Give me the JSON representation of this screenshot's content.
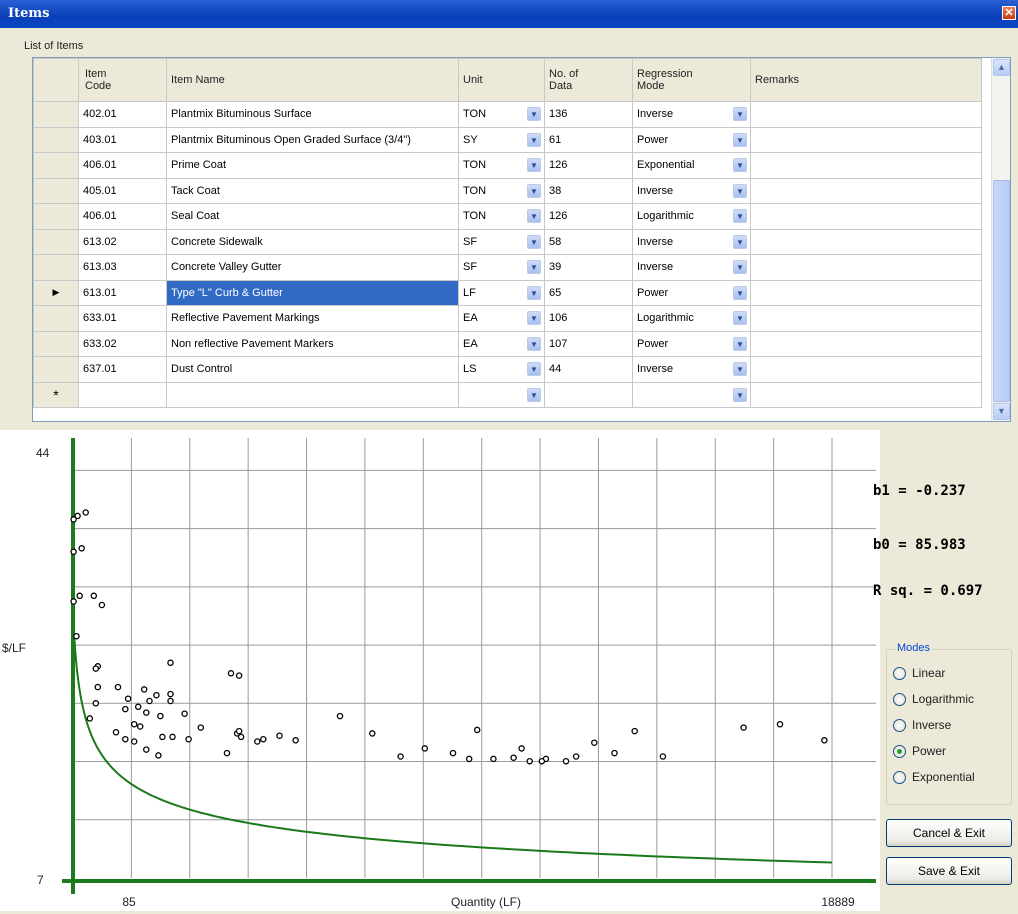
{
  "window": {
    "title": "Items",
    "close_glyph": "✕"
  },
  "group_label": "List of Items",
  "grid": {
    "columns": [
      "Item Code",
      "Item Name",
      "Unit",
      "No. of Data",
      "Regression Mode",
      "Remarks"
    ],
    "column_header_lines": [
      [
        "Item",
        "Code"
      ],
      [
        "Item Name"
      ],
      [
        "Unit"
      ],
      [
        "No. of",
        "Data"
      ],
      [
        "Regression",
        "Mode"
      ],
      [
        "Remarks"
      ]
    ],
    "rows": [
      {
        "code": "402.01",
        "name": "Plantmix Bituminous Surface",
        "unit": "TON",
        "count": "136",
        "mode": "Inverse",
        "remarks": ""
      },
      {
        "code": "403.01",
        "name": "Plantmix Bituminous Open Graded Surface (3/4\")",
        "unit": "SY",
        "count": "61",
        "mode": "Power",
        "remarks": ""
      },
      {
        "code": "406.01",
        "name": "Prime Coat",
        "unit": "TON",
        "count": "126",
        "mode": "Exponential",
        "remarks": ""
      },
      {
        "code": "405.01",
        "name": "Tack Coat",
        "unit": "TON",
        "count": "38",
        "mode": "Inverse",
        "remarks": ""
      },
      {
        "code": "406.01",
        "name": "Seal Coat",
        "unit": "TON",
        "count": "126",
        "mode": "Logarithmic",
        "remarks": ""
      },
      {
        "code": "613.02",
        "name": "Concrete Sidewalk",
        "unit": "SF",
        "count": "58",
        "mode": "Inverse",
        "remarks": ""
      },
      {
        "code": "613.03",
        "name": "Concrete Valley Gutter",
        "unit": "SF",
        "count": "39",
        "mode": "Inverse",
        "remarks": ""
      },
      {
        "code": "613.01",
        "name": "Type \"L\" Curb & Gutter",
        "unit": "LF",
        "count": "65",
        "mode": "Power",
        "remarks": "",
        "selected": true
      },
      {
        "code": "633.01",
        "name": "Reflective Pavement Markings",
        "unit": "EA",
        "count": "106",
        "mode": "Logarithmic",
        "remarks": ""
      },
      {
        "code": "633.02",
        "name": "Non reflective Pavement Markers",
        "unit": "EA",
        "count": "107",
        "mode": "Power",
        "remarks": ""
      },
      {
        "code": "637.01",
        "name": "Dust Control",
        "unit": "LS",
        "count": "44",
        "mode": "Inverse",
        "remarks": ""
      }
    ],
    "new_row_marker": "*",
    "current_row_marker": "▶"
  },
  "chart_data": {
    "type": "scatter",
    "xlabel": "Quantity (LF)",
    "ylabel": "$/LF",
    "xlim": [
      85,
      18889
    ],
    "ylim": [
      7,
      44
    ],
    "x_tick_labels": [
      "85",
      "18889"
    ],
    "y_tick_labels": [
      "44",
      "7"
    ],
    "grid": true,
    "fit": {
      "mode": "Power",
      "b1": -0.237,
      "b0": 85.983
    },
    "points": [
      [
        100,
        38
      ],
      [
        200,
        38.3
      ],
      [
        400,
        38.6
      ],
      [
        100,
        35.2
      ],
      [
        300,
        35.5
      ],
      [
        250,
        31.4
      ],
      [
        600,
        31.4
      ],
      [
        100,
        30.9
      ],
      [
        800,
        30.6
      ],
      [
        170,
        27.9
      ],
      [
        700,
        25.3
      ],
      [
        650,
        25.1
      ],
      [
        2500,
        25.6
      ],
      [
        4000,
        24.7
      ],
      [
        4200,
        24.5
      ],
      [
        700,
        23.5
      ],
      [
        1200,
        23.5
      ],
      [
        1850,
        23.3
      ],
      [
        2150,
        22.8
      ],
      [
        2500,
        22.9
      ],
      [
        650,
        22.1
      ],
      [
        1450,
        22.5
      ],
      [
        1980,
        22.3
      ],
      [
        2500,
        22.3
      ],
      [
        1380,
        21.6
      ],
      [
        1700,
        21.8
      ],
      [
        1900,
        21.3
      ],
      [
        2250,
        21.0
      ],
      [
        2850,
        21.2
      ],
      [
        500,
        20.8
      ],
      [
        1600,
        20.3
      ],
      [
        1750,
        20.1
      ],
      [
        3250,
        20.0
      ],
      [
        4150,
        19.5
      ],
      [
        4200,
        19.7
      ],
      [
        5200,
        19.3
      ],
      [
        1150,
        19.6
      ],
      [
        2300,
        19.2
      ],
      [
        2550,
        19.2
      ],
      [
        2950,
        19.0
      ],
      [
        6700,
        21.0
      ],
      [
        7500,
        19.5
      ],
      [
        1380,
        19.0
      ],
      [
        1600,
        18.8
      ],
      [
        4250,
        19.2
      ],
      [
        4650,
        18.8
      ],
      [
        4800,
        19.0
      ],
      [
        5600,
        18.9
      ],
      [
        10100,
        19.8
      ],
      [
        8800,
        18.2
      ],
      [
        3900,
        17.8
      ],
      [
        2200,
        17.6
      ],
      [
        1900,
        18.1
      ],
      [
        8200,
        17.5
      ],
      [
        16700,
        20.0
      ],
      [
        17600,
        20.3
      ],
      [
        18700,
        18.9
      ],
      [
        14000,
        19.7
      ],
      [
        13000,
        18.7
      ],
      [
        11200,
        18.2
      ],
      [
        13500,
        17.8
      ],
      [
        12550,
        17.5
      ],
      [
        9500,
        17.8
      ],
      [
        9900,
        17.3
      ],
      [
        12300,
        17.1
      ],
      [
        10500,
        17.3
      ],
      [
        11400,
        17.1
      ],
      [
        11800,
        17.3
      ],
      [
        14700,
        17.5
      ],
      [
        11000,
        17.4
      ],
      [
        11700,
        17.1
      ]
    ]
  },
  "stats": {
    "b1": "b1 = -0.237",
    "b0": "b0 = 85.983",
    "rsq": "R sq. = 0.697"
  },
  "modes": {
    "legend": "Modes",
    "options": [
      "Linear",
      "Logarithmic",
      "Inverse",
      "Power",
      "Exponential"
    ],
    "selected": "Power"
  },
  "buttons": {
    "cancel": "Cancel & Exit",
    "save": "Save & Exit"
  },
  "colors": {
    "axis": "#1e7a1e",
    "fit": "#1a7a1a",
    "selection": "#316ac5",
    "title_bar": "#0a3fb8"
  }
}
